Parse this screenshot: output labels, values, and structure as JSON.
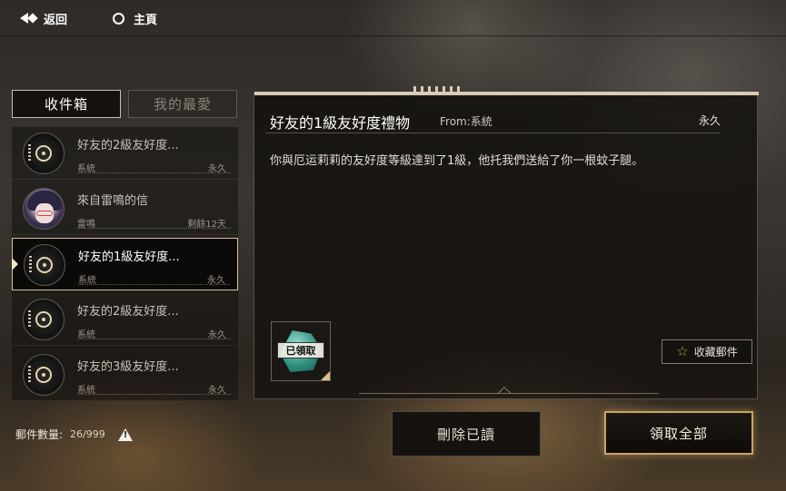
{
  "topbar": {
    "back_label": "返回",
    "home_label": "主頁"
  },
  "tabs": {
    "inbox": "收件箱",
    "favorites": "我的最愛"
  },
  "mail_list": [
    {
      "title": "好友的2級友好度...",
      "sender": "系統",
      "expiry": "永久",
      "avatar": "system-emblem-icon",
      "selected": false
    },
    {
      "title": "來自雷鳴的信",
      "sender": "雷鳴",
      "expiry": "剩餘12天",
      "avatar": "character-portrait",
      "selected": false
    },
    {
      "title": "好友的1級友好度...",
      "sender": "系統",
      "expiry": "永久",
      "avatar": "system-emblem-icon",
      "selected": true
    },
    {
      "title": "好友的2級友好度...",
      "sender": "系統",
      "expiry": "永久",
      "avatar": "system-emblem-icon",
      "selected": false
    },
    {
      "title": "好友的3級友好度...",
      "sender": "系統",
      "expiry": "永久",
      "avatar": "system-emblem-icon",
      "selected": false
    }
  ],
  "detail": {
    "title": "好友的1級友好度禮物",
    "from_label": "From:系統",
    "expiry": "永久",
    "body": "你與厄运莉莉的友好度等級達到了1級，他托我們送給了你一根蚊子腿。",
    "attachment_stamp": "已領取",
    "favorite_button": "收藏郵件"
  },
  "footer": {
    "count_label": "郵件數量:",
    "count_value": "26/999",
    "delete_read": "刪除已讀",
    "claim_all": "領取全部"
  },
  "colors": {
    "accent_gold": "#c9a466",
    "selected_border": "#d8c49c",
    "star": "#c7a34f"
  }
}
